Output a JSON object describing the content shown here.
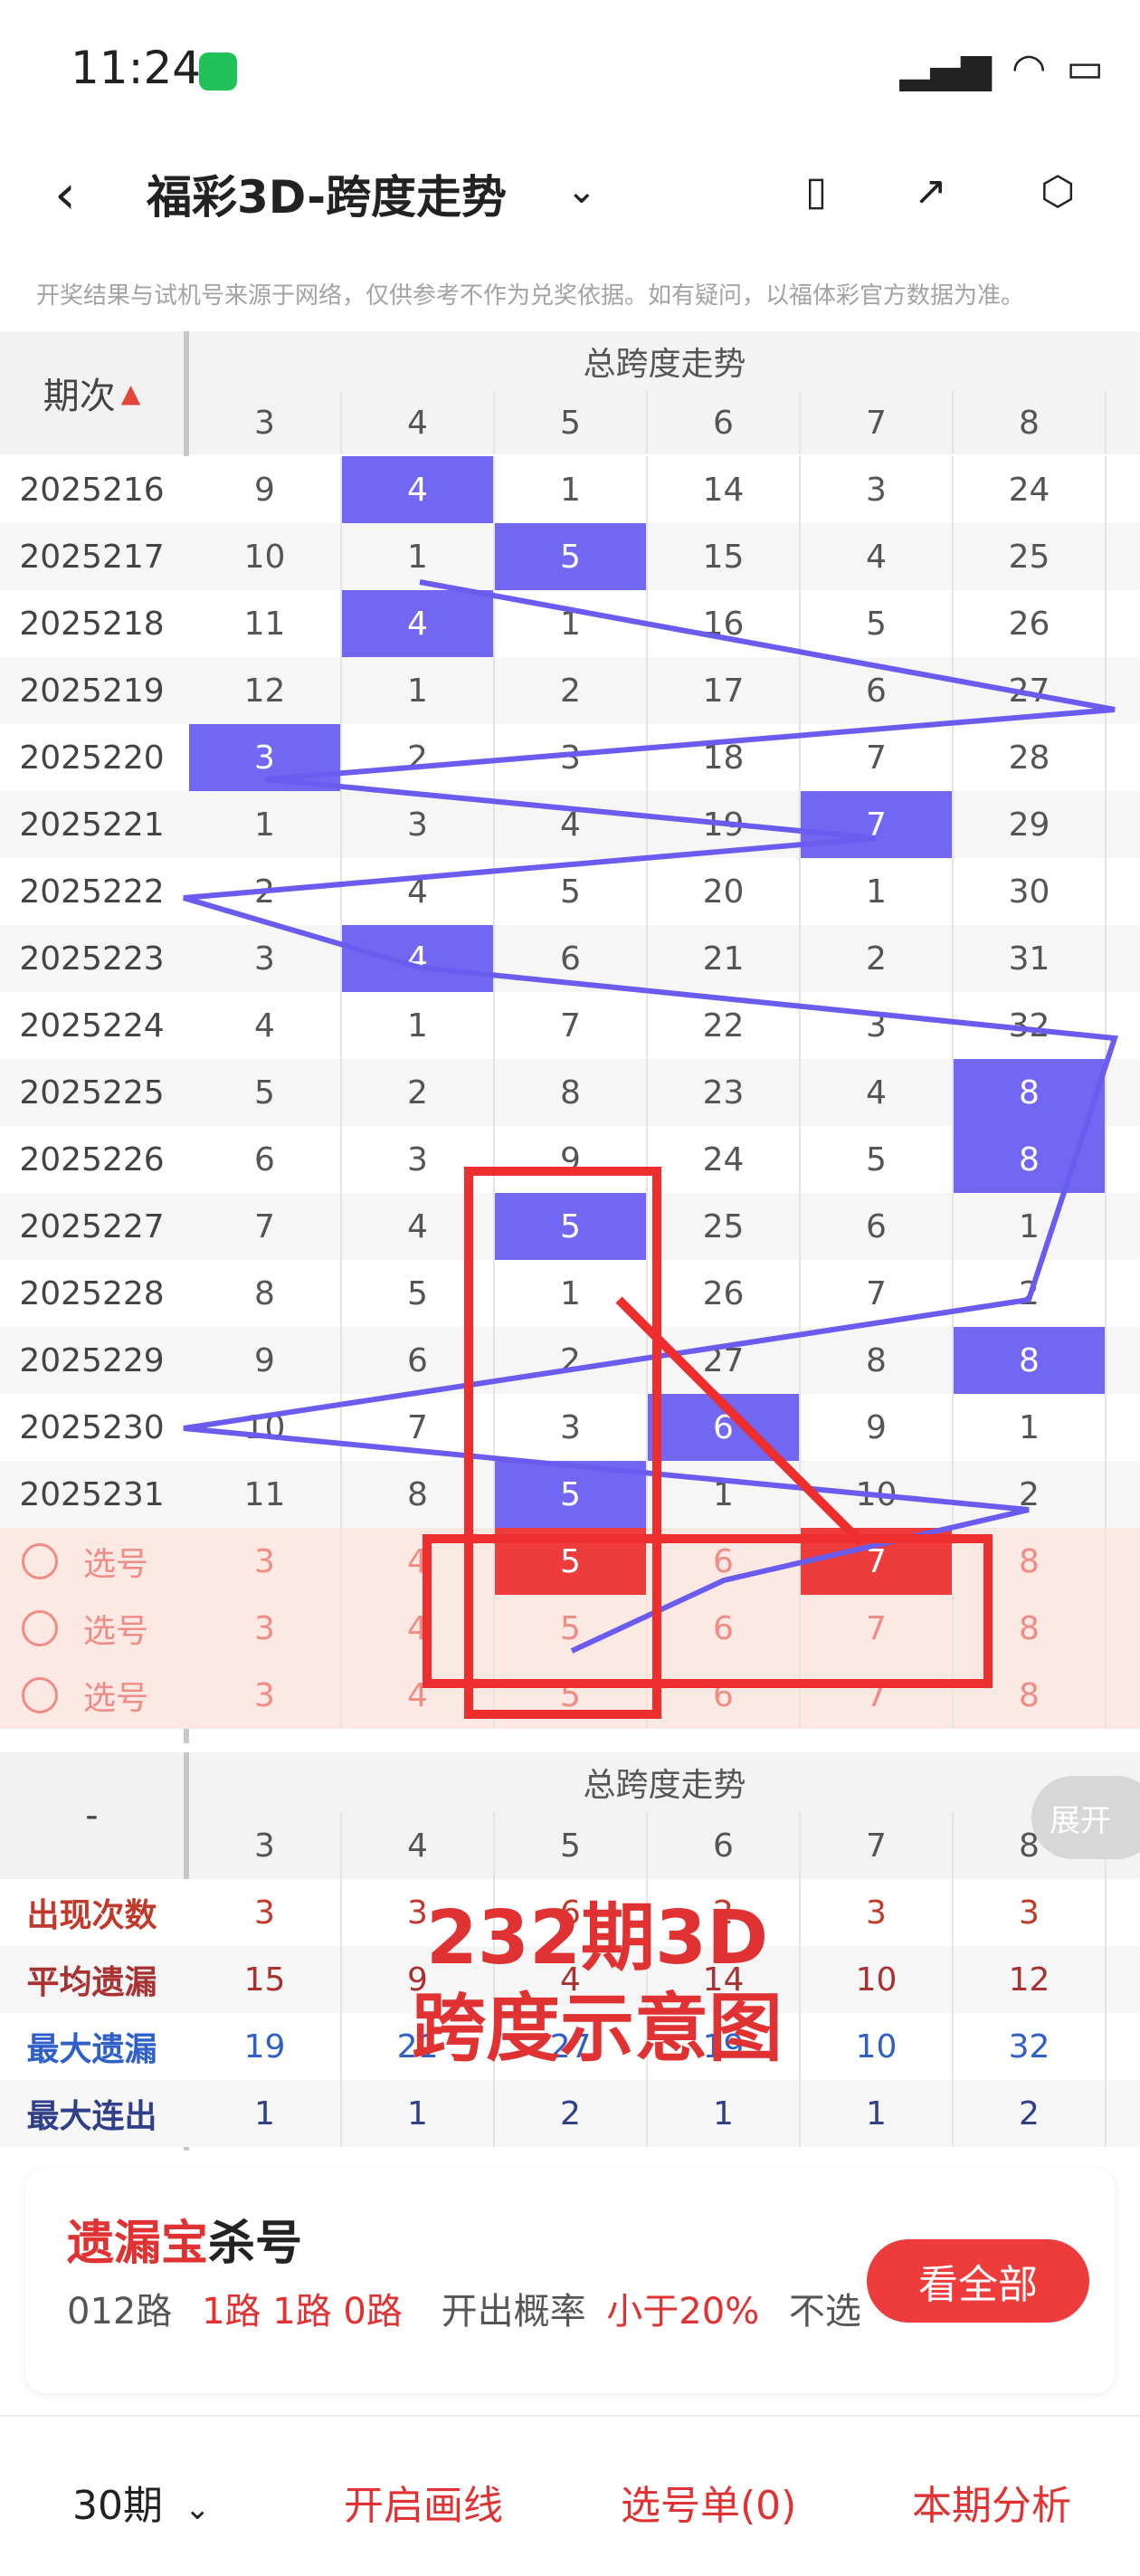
{
  "status_bar": {
    "time": "11:24",
    "battery_icon": "battery-icon"
  },
  "nav": {
    "title": "福彩3D-跨度走势"
  },
  "notice": "开奖结果与试机号来源于网络，仅供参考不作为兑奖依据。如有疑问，以福体彩官方数据为准。",
  "table": {
    "header_group": "总跨度走势",
    "col_header_left": "期次",
    "columns": [
      "3",
      "4",
      "5",
      "6",
      "7",
      "8"
    ],
    "rows": [
      {
        "issue": "2025216",
        "values": [
          "9",
          "4",
          "1",
          "14",
          "3",
          "24"
        ],
        "hit": 1
      },
      {
        "issue": "2025217",
        "values": [
          "10",
          "1",
          "5",
          "15",
          "4",
          "25"
        ],
        "hit": 2
      },
      {
        "issue": "2025218",
        "values": [
          "11",
          "4",
          "1",
          "16",
          "5",
          "26"
        ],
        "hit": 1
      },
      {
        "issue": "2025219",
        "values": [
          "12",
          "1",
          "2",
          "17",
          "6",
          "27"
        ],
        "hit": -1
      },
      {
        "issue": "2025220",
        "values": [
          "3",
          "2",
          "3",
          "18",
          "7",
          "28"
        ],
        "hit": 0
      },
      {
        "issue": "2025221",
        "values": [
          "1",
          "3",
          "4",
          "19",
          "7",
          "29"
        ],
        "hit": 4
      },
      {
        "issue": "2025222",
        "values": [
          "2",
          "4",
          "5",
          "20",
          "1",
          "30"
        ],
        "hit": -1
      },
      {
        "issue": "2025223",
        "values": [
          "3",
          "4",
          "6",
          "21",
          "2",
          "31"
        ],
        "hit": 1
      },
      {
        "issue": "2025224",
        "values": [
          "4",
          "1",
          "7",
          "22",
          "3",
          "32"
        ],
        "hit": -1
      },
      {
        "issue": "2025225",
        "values": [
          "5",
          "2",
          "8",
          "23",
          "4",
          "8"
        ],
        "hit": 5
      },
      {
        "issue": "2025226",
        "values": [
          "6",
          "3",
          "9",
          "24",
          "5",
          "8"
        ],
        "hit": 5
      },
      {
        "issue": "2025227",
        "values": [
          "7",
          "4",
          "5",
          "25",
          "6",
          "1"
        ],
        "hit": 2
      },
      {
        "issue": "2025228",
        "values": [
          "8",
          "5",
          "1",
          "26",
          "7",
          "2"
        ],
        "hit": -1
      },
      {
        "issue": "2025229",
        "values": [
          "9",
          "6",
          "2",
          "27",
          "8",
          "8"
        ],
        "hit": 5
      },
      {
        "issue": "2025230",
        "values": [
          "10",
          "7",
          "3",
          "6",
          "9",
          "1"
        ],
        "hit": 3
      },
      {
        "issue": "2025231",
        "values": [
          "11",
          "8",
          "5",
          "1",
          "10",
          "2"
        ],
        "hit": 2
      }
    ],
    "pick_rows": [
      {
        "label": "选号",
        "values": [
          "3",
          "4",
          "5",
          "6",
          "7",
          "8"
        ],
        "red": [
          2,
          4
        ]
      },
      {
        "label": "选号",
        "values": [
          "3",
          "4",
          "5",
          "6",
          "7",
          "8"
        ],
        "red": []
      },
      {
        "label": "选号",
        "values": [
          "3",
          "4",
          "5",
          "6",
          "7",
          "8"
        ],
        "red": []
      }
    ]
  },
  "stats": {
    "header_group": "总跨度走势",
    "left_label": "-",
    "expand_label": "展开",
    "rows": [
      {
        "label": "出现次数",
        "values": [
          "3",
          "3",
          "6",
          "2",
          "3",
          "3"
        ],
        "color": "#c0392b"
      },
      {
        "label": "平均遗漏",
        "values": [
          "15",
          "9",
          "4",
          "14",
          "10",
          "12"
        ],
        "color": "#a83232"
      },
      {
        "label": "最大遗漏",
        "values": [
          "19",
          "21",
          "27",
          "19",
          "10",
          "32"
        ],
        "color": "#2f5fc8"
      },
      {
        "label": "最大连出",
        "values": [
          "1",
          "1",
          "2",
          "1",
          "1",
          "2"
        ],
        "color": "#2f3f8a"
      }
    ],
    "overlay_line1": "232期3D",
    "overlay_line2": "跨度示意图"
  },
  "kill": {
    "title_red": "遗漏宝",
    "title_black": "杀号",
    "label1": "012路",
    "value1": "1路 1路 0路",
    "label2": "开出概率",
    "value2": "小于20%",
    "tail": "不选",
    "button": "看全部"
  },
  "bottom_bar": {
    "period": "30期",
    "draw": "开启画线",
    "selected": "选号单(0)",
    "analysis": "本期分析"
  }
}
